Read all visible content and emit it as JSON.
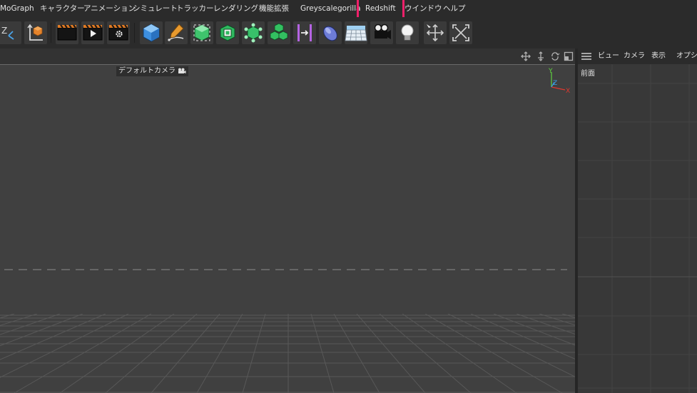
{
  "menu": [
    {
      "label": "MoGraph"
    },
    {
      "label": "キャラクター"
    },
    {
      "label": "アニメーション"
    },
    {
      "label": "シミュレート"
    },
    {
      "label": "トラッカー"
    },
    {
      "label": "レンダリング"
    },
    {
      "label": "機能拡張"
    },
    {
      "label": "Greyscalegorilla"
    },
    {
      "label": "Redshift"
    },
    {
      "label": "ウインドウ"
    },
    {
      "label": "ヘルプ"
    }
  ],
  "viewport": {
    "camera_label": "デフォルトカメラ",
    "axis": {
      "y": "Y",
      "z": "Z",
      "x": "X"
    }
  },
  "right_panel": {
    "menu": [
      "ビュー",
      "カメラ",
      "表示",
      "オプショ"
    ],
    "view_label": "前面"
  },
  "colors": {
    "highlight": "#f0206a",
    "axis_y": "#5fd23f",
    "axis_x": "#e0372e",
    "axis_z": "#3a9ee6"
  }
}
